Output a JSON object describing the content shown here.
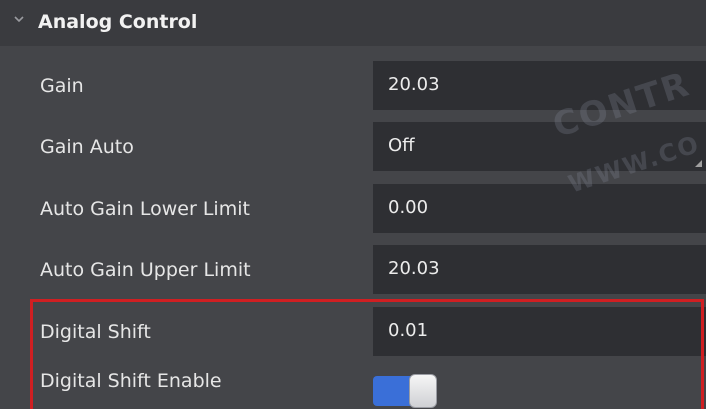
{
  "section": {
    "title": "Analog Control",
    "expanded_icon": "chevron-down-icon"
  },
  "params": [
    {
      "label": "Gain",
      "value": "20.03"
    },
    {
      "label": "Gain Auto",
      "value": "Off"
    },
    {
      "label": "Auto Gain Lower Limit",
      "value": "0.00"
    },
    {
      "label": "Auto Gain Upper Limit",
      "value": "20.03"
    },
    {
      "label": "Digital Shift",
      "value": "0.01"
    },
    {
      "label": "Digital Shift Enable",
      "value": ""
    }
  ],
  "watermark": {
    "line1": "CONTR",
    "line2": "WWW.CO"
  },
  "colors": {
    "background": "#444549",
    "field": "#2e2f33",
    "highlight": "#d01f22",
    "toggle_on": "#3a6fd8"
  }
}
